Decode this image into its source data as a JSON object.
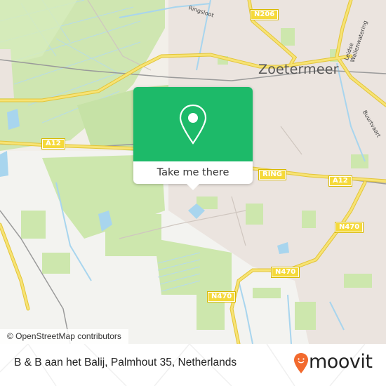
{
  "map": {
    "attribution": "© OpenStreetMap contributors",
    "city_label": "Zoetermeer",
    "street_labels": {
      "ringsloot": "Ringsloot",
      "wallenwatering": "Leidse Wallenwatering",
      "buurtvaart": "Buurtvaart"
    },
    "road_shields": {
      "n206": "N206",
      "a12_west": "A12",
      "ring": "RING",
      "a12_east": "A12",
      "n470_east": "N470",
      "n470_mid": "N470",
      "n470_south": "N470"
    },
    "colors": {
      "land": "#f2efe9",
      "park": "#cde7ad",
      "water": "#a8d5ee",
      "road_major": "#f5d93a",
      "urban": "#e9e2dc"
    }
  },
  "popup": {
    "cta_label": "Take me there",
    "icon": "map-pin-icon",
    "accent_color": "#1dba69"
  },
  "footer": {
    "address": "B & B aan het Balij, Palmhout 35, Netherlands",
    "logo_text": "moovit",
    "logo_color": "#f26a2e"
  }
}
